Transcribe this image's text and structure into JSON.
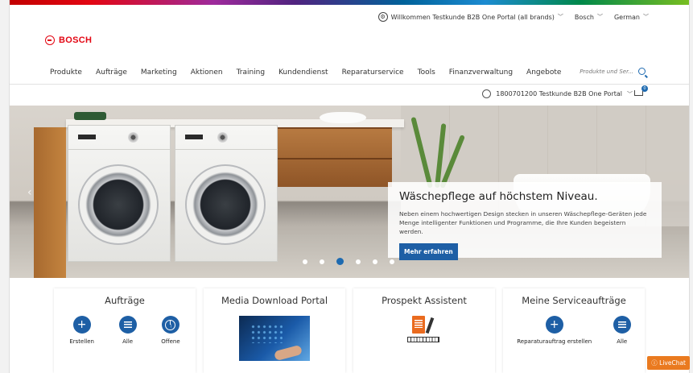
{
  "topbar": {
    "welcome": "Willkommen Testkunde B2B One Portal (all brands)",
    "brand": "Bosch",
    "language": "German"
  },
  "logo": {
    "text": "BOSCH"
  },
  "nav": {
    "items": [
      "Produkte",
      "Aufträge",
      "Marketing",
      "Aktionen",
      "Training",
      "Kundendienst",
      "Reparaturservice",
      "Tools",
      "Finanzverwaltung",
      "Angebote"
    ]
  },
  "search": {
    "placeholder": "Produkte und Ser..."
  },
  "account": {
    "label": "1800701200 Testkunde B2B One Portal",
    "cart_count": "0"
  },
  "hero": {
    "title": "Wäschepflege auf höchstem Niveau.",
    "text": "Neben einem hochwertigen Design stecken in unseren Wäschepflege-Geräten jede Menge intelligenter Funktionen und Programme, die Ihre Kunden begeistern werden.",
    "button": "Mehr erfahren",
    "slides": 6,
    "active_slide": 3
  },
  "tiles": {
    "auftraege": {
      "title": "Aufträge",
      "actions": [
        "Erstellen",
        "Alle",
        "Offene"
      ]
    },
    "media": {
      "title": "Media Download Portal"
    },
    "prospekt": {
      "title": "Prospekt Assistent"
    },
    "service": {
      "title": "Meine Serviceaufträge",
      "actions": [
        "Reparaturauftrag erstellen",
        "Alle"
      ]
    }
  },
  "livechat": {
    "label": "LiveChat"
  },
  "colors": {
    "brand_red": "#e30613",
    "accent_blue": "#1e5fa5",
    "livechat_orange": "#ea7a1f"
  }
}
